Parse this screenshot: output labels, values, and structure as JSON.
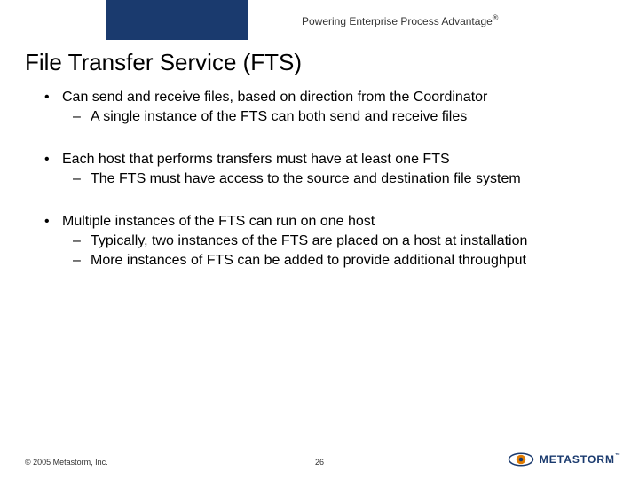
{
  "header": {
    "tagline": "Powering Enterprise Process Advantage",
    "tagline_mark": "®"
  },
  "title": "File Transfer Service (FTS)",
  "bullets": [
    {
      "text": "Can send and receive files, based on direction from the Coordinator",
      "sub": [
        "A single instance of the FTS can both send and receive files"
      ]
    },
    {
      "text": "Each host that performs transfers must have at least one FTS",
      "sub": [
        "The FTS must have access to the source and destination file system"
      ]
    },
    {
      "text": "Multiple instances of the FTS can run on one host",
      "sub": [
        "Typically, two instances of the FTS are placed on a host at installation",
        "More instances of FTS can be added to provide additional throughput"
      ]
    }
  ],
  "footer": {
    "copyright": "© 2005 Metastorm, Inc.",
    "page": "26",
    "logo_text": "METASTORM",
    "logo_tm": "™"
  }
}
